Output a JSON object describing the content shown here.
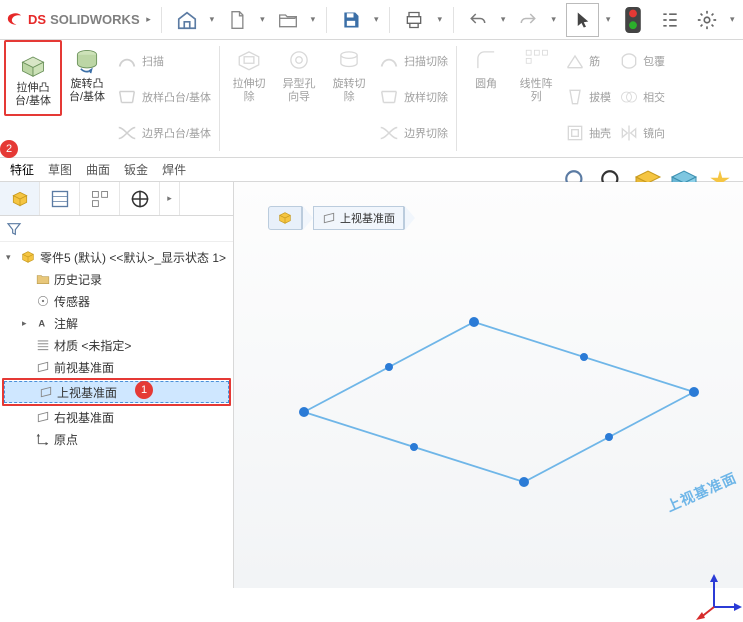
{
  "brand": {
    "name": "SOLIDWORKS",
    "ds": "DS"
  },
  "ribbon": {
    "extrude_boss": "拉伸凸\n台/基体",
    "revolve_boss": "旋转凸\n台/基体",
    "sweep": "扫描",
    "loft_boss": "放样凸台/基体",
    "boundary_boss": "边界凸台/基体",
    "extrude_cut": "拉伸切\n除",
    "hole_wizard": "异型孔\n向导",
    "revolve_cut": "旋转切\n除",
    "sweep_cut": "扫描切除",
    "loft_cut": "放样切除",
    "boundary_cut": "边界切除",
    "fillet": "圆角",
    "linear_pattern": "线性阵\n列",
    "rib": "筋",
    "draft": "拔模",
    "shell": "抽壳",
    "wrap": "包覆",
    "intersect": "相交",
    "mirror": "镜向"
  },
  "tabs": [
    "特征",
    "草图",
    "曲面",
    "钣金",
    "焊件"
  ],
  "tree": {
    "root": "零件5 (默认) <<默认>_显示状态 1>",
    "history": "历史记录",
    "sensors": "传感器",
    "annotations": "注解",
    "material": "材质 <未指定>",
    "front_plane": "前视基准面",
    "top_plane": "上视基准面",
    "right_plane": "右视基准面",
    "origin": "原点"
  },
  "breadcrumb": {
    "plane": "上视基准面"
  },
  "canvas": {
    "plane_label": "上视基准面"
  },
  "badges": {
    "b1": "1",
    "b2": "2"
  }
}
